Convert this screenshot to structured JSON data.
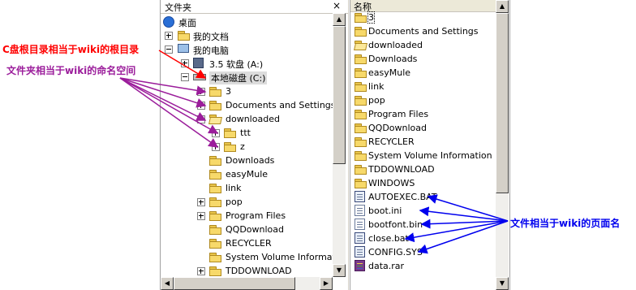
{
  "tree_pane": {
    "title": "文件夹",
    "close_symbol": "×",
    "items": [
      {
        "label": "桌面"
      },
      {
        "label": "我的文档"
      },
      {
        "label": "我的电脑"
      },
      {
        "label": "3.5 软盘 (A:)"
      },
      {
        "label": "本地磁盘 (C:)"
      },
      {
        "label": "3"
      },
      {
        "label": "Documents and Settings"
      },
      {
        "label": "downloaded"
      },
      {
        "label": "ttt"
      },
      {
        "label": "z"
      },
      {
        "label": "Downloads"
      },
      {
        "label": "easyMule"
      },
      {
        "label": "link"
      },
      {
        "label": "pop"
      },
      {
        "label": "Program Files"
      },
      {
        "label": "QQDownload"
      },
      {
        "label": "RECYCLER"
      },
      {
        "label": "System Volume Information"
      },
      {
        "label": "TDDOWNLOAD"
      }
    ]
  },
  "list_pane": {
    "column_header": "名称",
    "items": [
      {
        "label": "3"
      },
      {
        "label": "Documents and Settings"
      },
      {
        "label": "downloaded"
      },
      {
        "label": "Downloads"
      },
      {
        "label": "easyMule"
      },
      {
        "label": "link"
      },
      {
        "label": "pop"
      },
      {
        "label": "Program Files"
      },
      {
        "label": "QQDownload"
      },
      {
        "label": "RECYCLER"
      },
      {
        "label": "System Volume Information"
      },
      {
        "label": "TDDOWNLOAD"
      },
      {
        "label": "WINDOWS"
      },
      {
        "label": "AUTOEXEC.BAT"
      },
      {
        "label": "boot.ini"
      },
      {
        "label": "bootfont.bin"
      },
      {
        "label": "close.bat"
      },
      {
        "label": "CONFIG.SYS"
      },
      {
        "label": "data.rar"
      }
    ]
  },
  "annotations": {
    "root_dir": "C盘根目录相当于wiki的根目录",
    "namespace": "文件夹相当于wiki的命名空间",
    "page_name": "文件相当于wiki的页面名"
  },
  "colors": {
    "root_annotation": "#ff0000",
    "namespace_annotation": "#9b1d9b",
    "page_annotation": "#0000ee"
  }
}
